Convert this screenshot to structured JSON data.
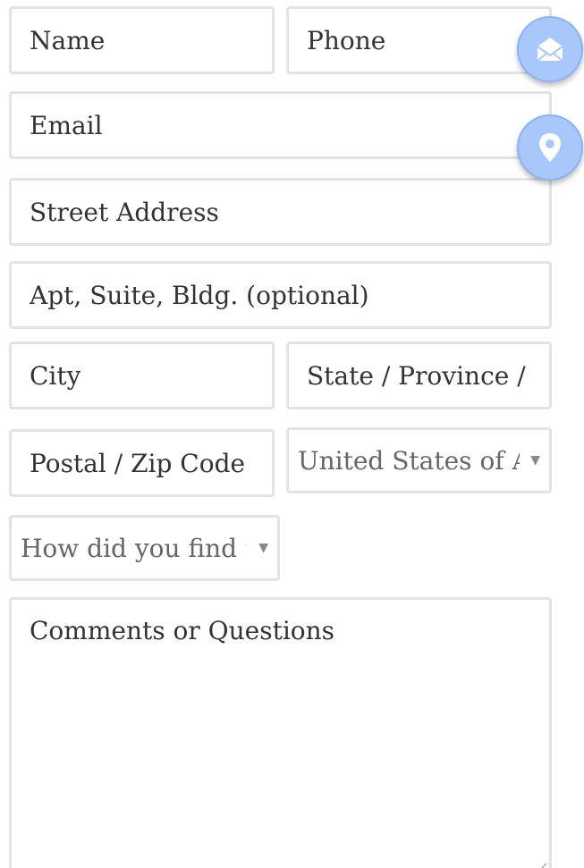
{
  "form": {
    "name_placeholder": "Name",
    "phone_placeholder": "Phone",
    "email_placeholder": "Email",
    "street_placeholder": "Street Address",
    "apt_placeholder": "Apt, Suite, Bldg. (optional)",
    "city_placeholder": "City",
    "state_placeholder": "State / Province / Region",
    "postal_placeholder": "Postal / Zip Code",
    "country_selected": "United States of America",
    "source_selected": "How did you find us?",
    "comments_placeholder": "Comments or Questions"
  },
  "floating_buttons": {
    "mail_icon": "envelope-open-icon",
    "location_icon": "map-pin-icon",
    "color": "#a8c8fb"
  },
  "colors": {
    "border": "#e3e3e3",
    "text": "#333333",
    "select_text": "#666666"
  }
}
